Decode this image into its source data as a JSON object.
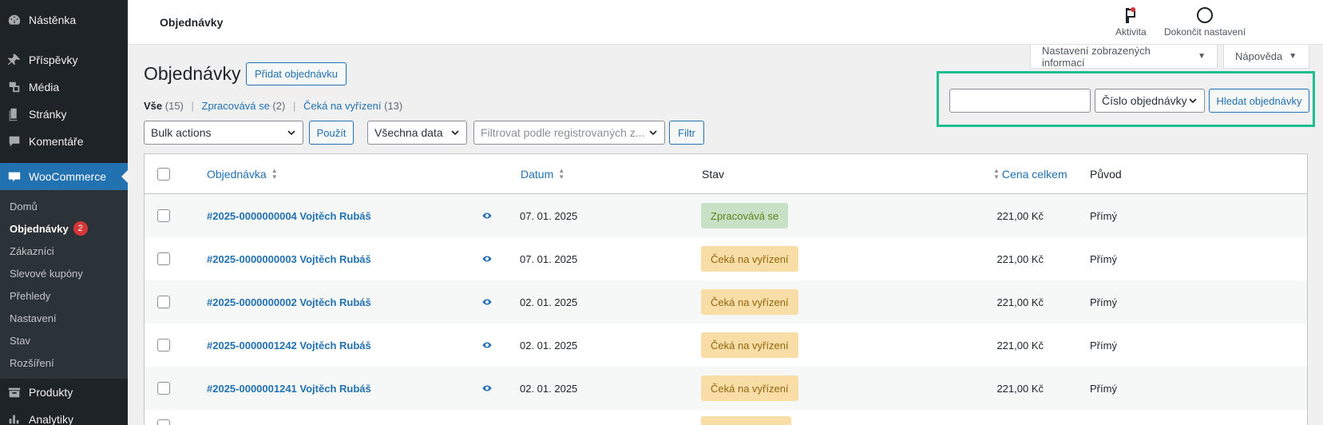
{
  "sidebar": {
    "items_top": [
      {
        "label": "Nástěnka",
        "icon": "dashboard-icon"
      },
      {
        "label": "Příspěvky",
        "icon": "pin-icon"
      },
      {
        "label": "Média",
        "icon": "media-icon"
      },
      {
        "label": "Stránky",
        "icon": "pages-icon"
      },
      {
        "label": "Komentáře",
        "icon": "comment-icon"
      },
      {
        "label": "WooCommerce",
        "icon": "woo-icon"
      }
    ],
    "submenu": [
      {
        "label": "Domů"
      },
      {
        "label": "Objednávky",
        "badge": "2"
      },
      {
        "label": "Zákazníci"
      },
      {
        "label": "Slevové kupóny"
      },
      {
        "label": "Přehledy"
      },
      {
        "label": "Nastavení"
      },
      {
        "label": "Stav"
      },
      {
        "label": "Rozšíření"
      }
    ],
    "items_bottom": [
      {
        "label": "Produkty",
        "icon": "products-icon"
      },
      {
        "label": "Analytiky",
        "icon": "analytics-icon"
      }
    ]
  },
  "topbar": {
    "title": "Objednávky",
    "activity_label": "Aktivita",
    "finish_setup_label": "Dokončit nastavení"
  },
  "screen_tabs": {
    "screen_options": "Nastavení zobrazených informací",
    "help": "Nápověda"
  },
  "heading": {
    "title": "Objednávky",
    "add_button": "Přidat objednávku"
  },
  "filters": {
    "views": [
      {
        "label": "Vše",
        "count": "(15)",
        "current": true
      },
      {
        "label": "Zpracovává se",
        "count": "(2)"
      },
      {
        "label": "Čeká na vyřízení",
        "count": "(13)"
      }
    ],
    "bulk_actions": "Bulk actions",
    "apply": "Použít",
    "dates": "Všechna data",
    "customer_placeholder": "Filtrovat podle registrovaných z...",
    "filter_button": "Filtr"
  },
  "search": {
    "input_value": "",
    "field_select": "Číslo objednávky",
    "button": "Hledat objednávky",
    "highlight_color": "#1fbf8f"
  },
  "table": {
    "headers": {
      "order": "Objednávka",
      "date": "Datum",
      "status": "Stav",
      "total": "Cena celkem",
      "origin": "Původ"
    },
    "rows": [
      {
        "order": "#2025-0000000004 Vojtěch Rubáš",
        "date": "07. 01. 2025",
        "status": "Zpracovává se",
        "status_type": "processing",
        "total": "221,00 Kč",
        "origin": "Přímý"
      },
      {
        "order": "#2025-0000000003 Vojtěch Rubáš",
        "date": "07. 01. 2025",
        "status": "Čeká na vyřízení",
        "status_type": "onhold",
        "total": "221,00 Kč",
        "origin": "Přímý"
      },
      {
        "order": "#2025-0000000002 Vojtěch Rubáš",
        "date": "02. 01. 2025",
        "status": "Čeká na vyřízení",
        "status_type": "onhold",
        "total": "221,00 Kč",
        "origin": "Přímý"
      },
      {
        "order": "#2025-0000001242 Vojtěch Rubáš",
        "date": "02. 01. 2025",
        "status": "Čeká na vyřízení",
        "status_type": "onhold",
        "total": "221,00 Kč",
        "origin": "Přímý"
      },
      {
        "order": "#2025-0000001241 Vojtěch Rubáš",
        "date": "02. 01. 2025",
        "status": "Čeká na vyřízení",
        "status_type": "onhold",
        "total": "221,00 Kč",
        "origin": "Přímý"
      }
    ]
  },
  "colors": {
    "accent": "#2271b1",
    "sidebar_bg": "#1d2327",
    "processing_bg": "#c6e1c6",
    "onhold_bg": "#f8dda7"
  }
}
